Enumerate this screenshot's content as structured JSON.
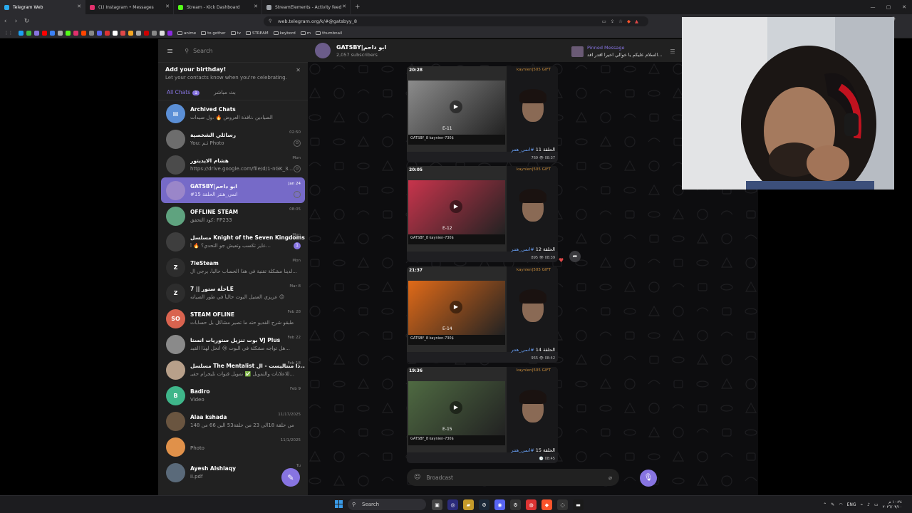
{
  "browser": {
    "tabs": [
      {
        "title": "Telegram Web",
        "color": "#2aabee",
        "active": true
      },
      {
        "title": "(1) Instagram • Messages",
        "color": "#e1306c",
        "active": false
      },
      {
        "title": "Stream - Kick Dashboard",
        "color": "#53fc18",
        "active": false
      },
      {
        "title": "StreamElements - Activity feed",
        "color": "#9ea2a8",
        "active": false
      }
    ],
    "new_tab": "+",
    "url": "web.telegram.org/k/#@gatsbyy_8",
    "bookmarks": [
      {
        "label": "anime"
      },
      {
        "label": "to gother"
      },
      {
        "label": "tv"
      },
      {
        "label": "STREAM"
      },
      {
        "label": "keybord"
      },
      {
        "label": "m"
      },
      {
        "label": "thumbnail"
      }
    ]
  },
  "sidebar": {
    "search_placeholder": "Search",
    "birthday_title": "Add your birthday!",
    "birthday_text": "Let your contacts know when you're celebrating.",
    "folders": [
      {
        "label": "All Chats",
        "badge": "1"
      },
      {
        "label": "بث مباشر",
        "badge": ""
      }
    ],
    "chats": [
      {
        "name": "Archived Chats",
        "preview": "الصيادين ،نافذة العروض 🔥 ،ول صيدات",
        "time": "",
        "avatar_color": "#5b8fd6",
        "initials": "▤",
        "mark": "",
        "active": false
      },
      {
        "name": "رسائلي الشخصية",
        "preview": "You: ئـم Photo",
        "time": "02:50",
        "avatar_color": "#6d6d6d",
        "initials": "",
        "mark": "pin",
        "active": false
      },
      {
        "name": "هشام الايديتور",
        "preview": "https://drive.google.com/file/d/1-nGK_3...",
        "time": "Mon",
        "avatar_color": "#4b4b4b",
        "initials": "",
        "mark": "pin",
        "active": false
      },
      {
        "name": "GATSBY|ابو داحم",
        "preview": "#انمي_هنتر الحلقة 15",
        "time": "Jan 24",
        "avatar_color": "#9a86c9",
        "initials": "",
        "mark": "pin",
        "active": true
      },
      {
        "name": "OFFLINE STEAM",
        "preview": "كود التحقق: FP233",
        "time": "08:05",
        "avatar_color": "#5fa37f",
        "initials": "",
        "mark": "",
        "active": false
      },
      {
        "name": "مسلسل Knight of the Seven Kingdoms ...",
        "preview": "عايز تكسب وتعيش جو التحدي؟ 🔥 أ...",
        "time": "Mon",
        "avatar_color": "#3e3e3e",
        "initials": "",
        "mark": "1",
        "active": false
      },
      {
        "name": "7leSteam",
        "preview": "لدينا مشكلة تقنية في هذا الحساب حالياً، يرجى ال...",
        "time": "Mon",
        "avatar_color": "#2d2d2d",
        "initials": "Z",
        "mark": "",
        "active": false
      },
      {
        "name": "حلّة ستور || 7LE",
        "preview": "عزيزي العميل البوت حالياً في طور الصيانه 😊",
        "time": "Mar 8",
        "avatar_color": "#2d2d2d",
        "initials": "Z",
        "mark": "",
        "active": false
      },
      {
        "name": "STEAM OFLINE",
        "preview": "طبقو شرح الفديو حته ما تصير مشاكل بل حسابات",
        "time": "Feb 28",
        "avatar_color": "#d9634f",
        "initials": "SO",
        "mark": "",
        "active": false
      },
      {
        "name": "بوت تنزيل ستوريات انستا VJ Plus",
        "preview": "هل تواجه مشكلة في البوت 😢 أنحل لهذا القيد...",
        "time": "Feb 22",
        "avatar_color": "#8a8a8a",
        "initials": "",
        "mark": "",
        "active": false
      },
      {
        "name": "مسلسل The Mentalist ذا منتاليست - ال...",
        "preview": "للاعلانات والتمويل ✅ تمويل قنوات تليجرام حقيـ...",
        "time": "Feb 18",
        "avatar_color": "#b8a08a",
        "initials": "",
        "mark": "",
        "active": false
      },
      {
        "name": "Badiro",
        "preview": "Video",
        "time": "Feb 9",
        "avatar_color": "#3fb68a",
        "initials": "B",
        "mark": "",
        "active": false
      },
      {
        "name": "Alaa kshada",
        "preview": "من حلقة 18الى 23 من حلقة53 الين 66 من 148",
        "time": "11/17/2025",
        "avatar_color": "#6a5540",
        "initials": "",
        "mark": "",
        "active": false
      },
      {
        "name": "",
        "preview": "Photo",
        "time": "11/1/2025",
        "avatar_color": "#e0914a",
        "initials": "",
        "mark": "",
        "active": false
      },
      {
        "name": "Ayesh Alshlaqy",
        "preview": "ii.pdf",
        "time": "Tu",
        "avatar_color": "#5a6a7a",
        "initials": "",
        "mark": "",
        "active": false
      }
    ]
  },
  "channel": {
    "title": "GATSBY|ابو داحم",
    "subscribers": "2,057 subscribers",
    "pinned_label": "Pinned Message",
    "pinned_text": "السلام عليكم يا خوالي اخيرا اقدر اقد...",
    "composer_placeholder": "Broadcast",
    "posts": [
      {
        "time": "20:28",
        "gift": "kaynien|505 GIFT",
        "episode": "E-11",
        "caption": "الحلقة 11",
        "hashtag": "#انمي_هنتر",
        "meta": "769 👁 08:37",
        "thumb_color": "#8c8c8c"
      },
      {
        "time": "20:05",
        "gift": "kaynien|505 GIFT",
        "episode": "E-12",
        "caption": "الحلقة 12",
        "hashtag": "#انمي_هنتر",
        "meta": "895 👁 08:39",
        "thumb_color": "#c8344c"
      },
      {
        "time": "21:37",
        "gift": "kaynien|505 GIFT",
        "episode": "E-14",
        "caption": "الحلقة 14",
        "hashtag": "#انمي_هنتر",
        "meta": "955 👁 08:42",
        "thumb_color": "#e06a18"
      },
      {
        "time": "19:36",
        "gift": "kaynien|505 GIFT",
        "episode": "E-15",
        "caption": "الحلقة 15",
        "hashtag": "#انمي_هنتر",
        "meta": "🕒 08:45",
        "thumb_color": "#4f6a42"
      }
    ],
    "post_brand": "GATSBY_8",
    "post_code": "kaynien-730$"
  },
  "taskbar": {
    "search": "Search",
    "lang": "ENG",
    "time": "١٠:٢٤ م",
    "date": "٢٠٢٦/٠٣/١٠"
  }
}
